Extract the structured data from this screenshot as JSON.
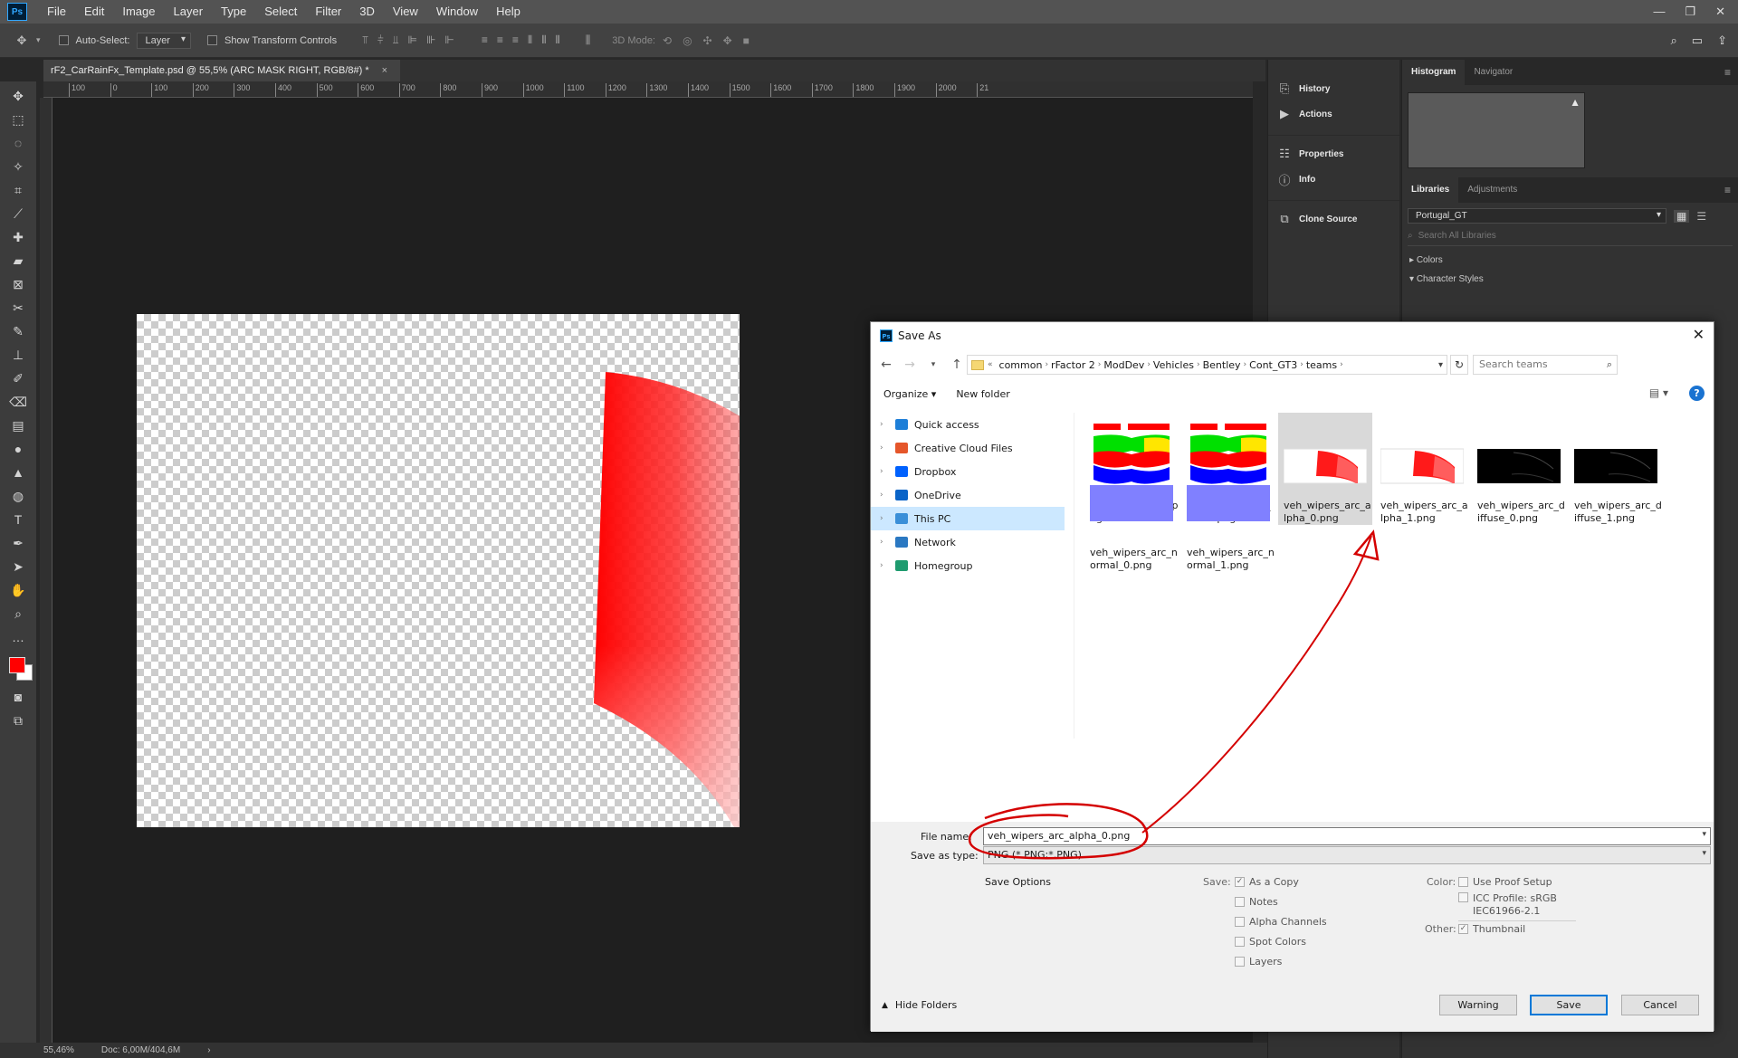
{
  "app": {
    "logo": "Ps",
    "menu": [
      "File",
      "Edit",
      "Image",
      "Layer",
      "Type",
      "Select",
      "Filter",
      "3D",
      "View",
      "Window",
      "Help"
    ]
  },
  "options": {
    "auto_select_label": "Auto-Select:",
    "auto_select_value": "Layer",
    "transform_label": "Show Transform Controls",
    "mode_label": "3D Mode:"
  },
  "document": {
    "tab_title": "rF2_CarRainFx_Template.psd @ 55,5% (ARC MASK RIGHT, RGB/8#) *",
    "ruler_ticks": [
      "100",
      "0",
      "100",
      "200",
      "300",
      "400",
      "500",
      "600",
      "700",
      "800",
      "900",
      "1000",
      "1100",
      "1200",
      "1300",
      "1400",
      "1500",
      "1600",
      "1700",
      "1800",
      "1900",
      "2000",
      "21"
    ],
    "zoom": "55,46%",
    "doc_size": "Doc: 6,00M/404,6M"
  },
  "colors": {
    "foreground": "#ff0000",
    "background": "#ffffff",
    "accent": "#0078d7",
    "annotation": "#d40000"
  },
  "dock": {
    "items": [
      {
        "label": "History",
        "icon": "history-icon"
      },
      {
        "label": "Actions",
        "icon": "play-icon"
      },
      {
        "label": "Properties",
        "icon": "properties-icon"
      },
      {
        "label": "Info",
        "icon": "info-icon"
      },
      {
        "label": "Clone Source",
        "icon": "clone-source-icon"
      }
    ]
  },
  "panels": {
    "top_tabs": [
      "Histogram",
      "Navigator"
    ],
    "lib_tabs": [
      "Libraries",
      "Adjustments"
    ],
    "library_value": "Portugal_GT",
    "search_placeholder": "Search All Libraries",
    "sections": [
      "Colors",
      "Character Styles"
    ]
  },
  "dialog": {
    "title": "Save As",
    "breadcrumbs": [
      "common",
      "rFactor 2",
      "ModDev",
      "Vehicles",
      "Bentley",
      "Cont_GT3",
      "teams"
    ],
    "search_placeholder": "Search teams",
    "organize": "Organize",
    "new_folder": "New folder",
    "nav": [
      {
        "label": "Quick access",
        "icon": "star-icon",
        "color": "#1e7fd8"
      },
      {
        "label": "Creative Cloud Files",
        "icon": "creative-cloud-icon",
        "color": "#e5562a"
      },
      {
        "label": "Dropbox",
        "icon": "dropbox-icon",
        "color": "#0061fe"
      },
      {
        "label": "OneDrive",
        "icon": "onedrive-icon",
        "color": "#0a64c8"
      },
      {
        "label": "This PC",
        "icon": "computer-icon",
        "color": "#3a8fd8"
      },
      {
        "label": "Network",
        "icon": "network-icon",
        "color": "#2a78c2"
      },
      {
        "label": "Homegroup",
        "icon": "homegroup-icon",
        "color": "#1f9b6f"
      }
    ],
    "files": [
      {
        "name": "veh_ripple_map.png",
        "kind": "ripple"
      },
      {
        "name": "veh_ripple_map_video.png",
        "kind": "ripple"
      },
      {
        "name": "veh_wipers_arc_alpha_0.png",
        "kind": "alpha"
      },
      {
        "name": "veh_wipers_arc_alpha_1.png",
        "kind": "alpha"
      },
      {
        "name": "veh_wipers_arc_diffuse_0.png",
        "kind": "diffuse"
      },
      {
        "name": "veh_wipers_arc_diffuse_1.png",
        "kind": "diffuse"
      },
      {
        "name": "veh_wipers_arc_normal_0.png",
        "kind": "normal"
      },
      {
        "name": "veh_wipers_arc_normal_1.png",
        "kind": "normal"
      }
    ],
    "file_name_label": "File name:",
    "file_name_value": "veh_wipers_arc_alpha_0.png",
    "type_label": "Save as type:",
    "type_value": "PNG (*.PNG;*.PNG)",
    "save_options_label": "Save Options",
    "save_label": "Save:",
    "save_opts": [
      {
        "label": "As a Copy",
        "checked": true
      },
      {
        "label": "Notes",
        "checked": false
      },
      {
        "label": "Alpha Channels",
        "checked": false
      },
      {
        "label": "Spot Colors",
        "checked": false
      },
      {
        "label": "Layers",
        "checked": false
      }
    ],
    "color_label": "Color:",
    "use_proof": "Use Proof Setup",
    "icc_label": "ICC Profile:  sRGB",
    "icc_value": "IEC61966-2.1",
    "other_label": "Other:",
    "thumbnail": "Thumbnail",
    "hide_folders": "Hide Folders",
    "buttons": {
      "warning": "Warning",
      "save": "Save",
      "cancel": "Cancel"
    }
  }
}
